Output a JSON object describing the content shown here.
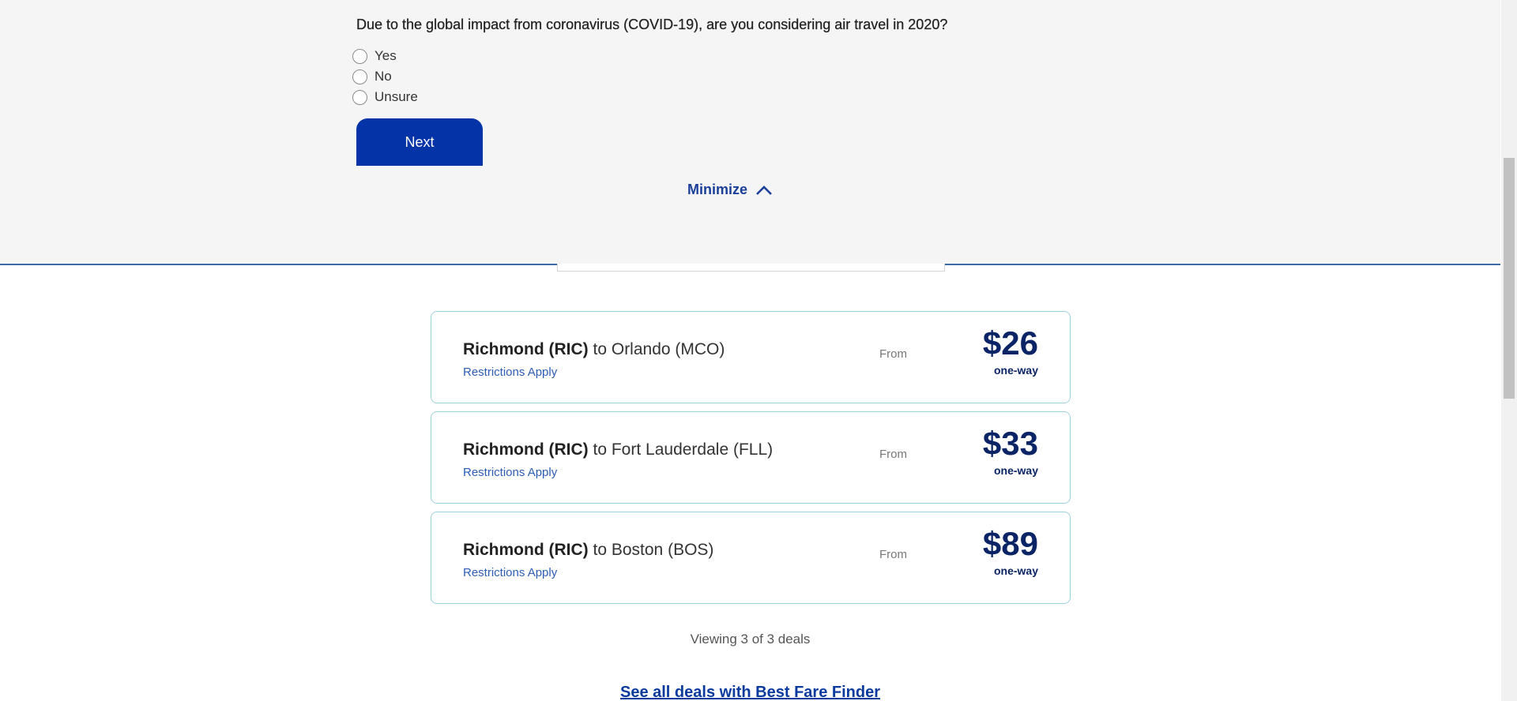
{
  "survey": {
    "question": "Due to the global impact from coronavirus (COVID-19), are you considering air travel in 2020?",
    "options": [
      {
        "label": "Yes"
      },
      {
        "label": "No"
      },
      {
        "label": "Unsure"
      }
    ],
    "next_label": "Next",
    "minimize_label": "Minimize"
  },
  "deals": [
    {
      "origin": "Richmond (RIC)",
      "connector": "to",
      "destination": "Orlando (MCO)",
      "restrictions": "Restrictions Apply",
      "from": "From",
      "price": "$26",
      "per": "one-way"
    },
    {
      "origin": "Richmond (RIC)",
      "connector": "to",
      "destination": "Fort Lauderdale (FLL)",
      "restrictions": "Restrictions Apply",
      "from": "From",
      "price": "$33",
      "per": "one-way"
    },
    {
      "origin": "Richmond (RIC)",
      "connector": "to",
      "destination": "Boston (BOS)",
      "restrictions": "Restrictions Apply",
      "from": "From",
      "price": "$89",
      "per": "one-way"
    }
  ],
  "viewing_text": "Viewing 3 of 3 deals",
  "see_all_label": "See all deals with Best Fare Finder",
  "colors": {
    "primary_button": "#0433a8",
    "price": "#0a2466",
    "link": "#2d5db5",
    "card_border": "#9fd0de"
  },
  "icons": {
    "minimize": "chevron-up-icon"
  }
}
